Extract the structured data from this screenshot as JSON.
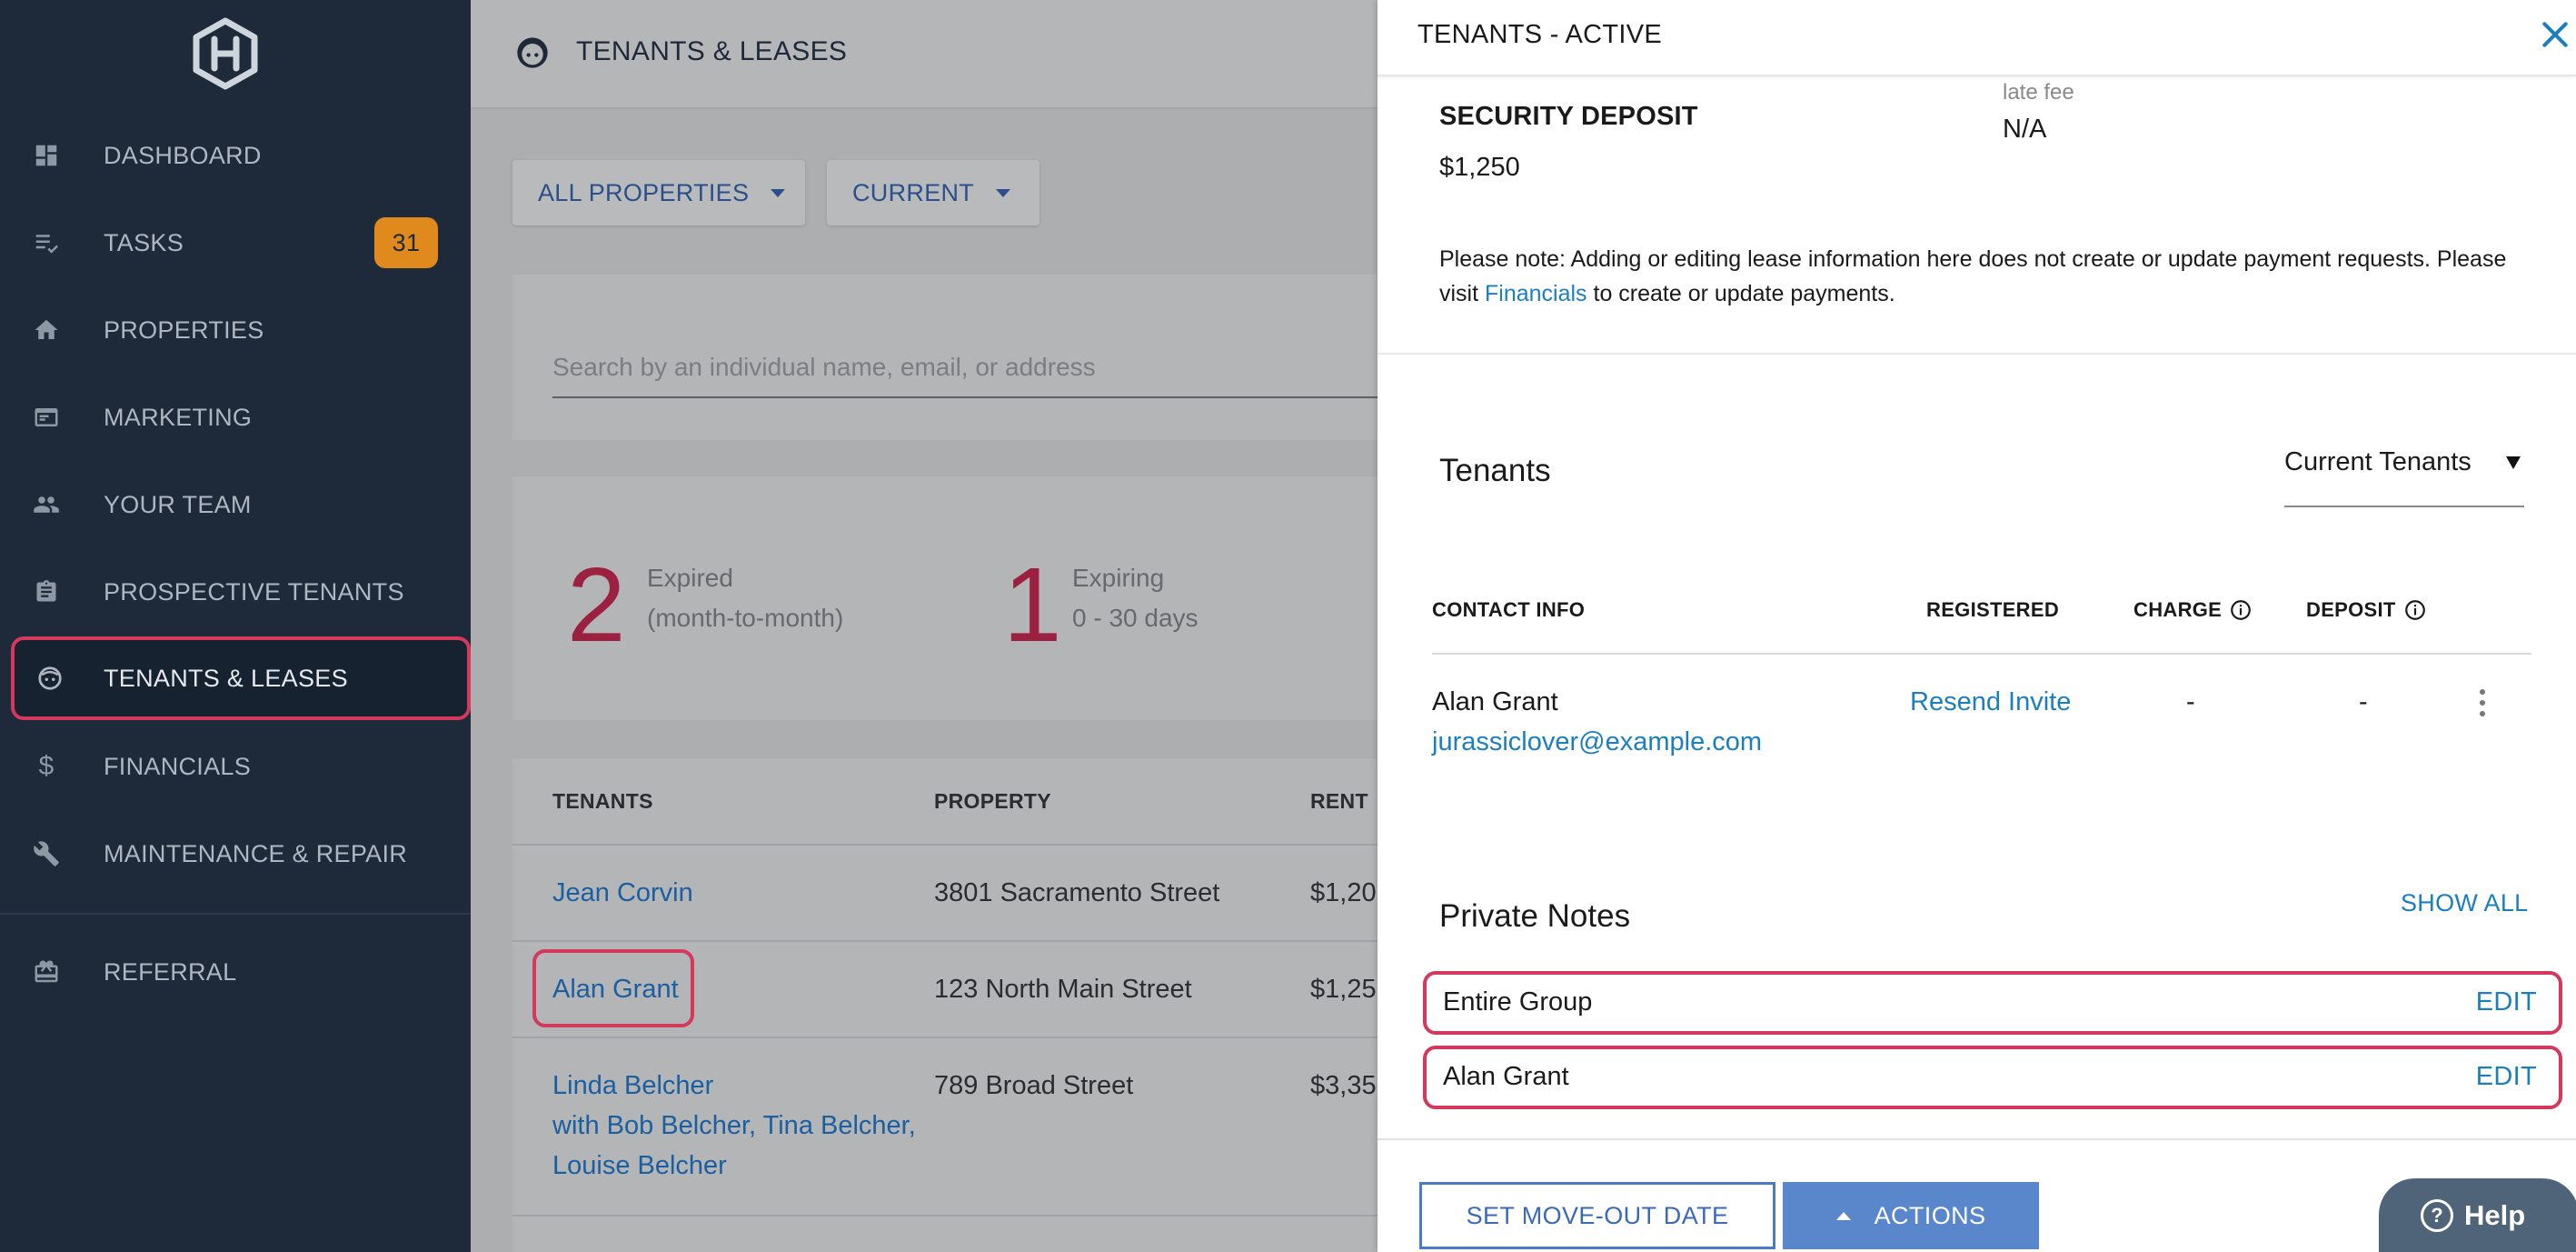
{
  "sidebar": {
    "items": [
      {
        "label": "DASHBOARD",
        "icon": "dashboard-icon"
      },
      {
        "label": "TASKS",
        "icon": "tasks-icon",
        "badge": "31"
      },
      {
        "label": "PROPERTIES",
        "icon": "home-icon"
      },
      {
        "label": "MARKETING",
        "icon": "marketing-icon"
      },
      {
        "label": "YOUR TEAM",
        "icon": "team-icon"
      },
      {
        "label": "PROSPECTIVE TENANTS",
        "icon": "clipboard-icon"
      },
      {
        "label": "TENANTS & LEASES",
        "icon": "tenant-face-icon",
        "active": true
      },
      {
        "label": "FINANCIALS",
        "icon": "dollar-icon"
      },
      {
        "label": "MAINTENANCE & REPAIR",
        "icon": "wrench-icon"
      },
      {
        "label": "REFERRAL",
        "icon": "gift-icon"
      }
    ]
  },
  "main": {
    "page_title": "TENANTS & LEASES",
    "filters": {
      "properties": "ALL PROPERTIES",
      "status": "CURRENT"
    },
    "search": {
      "placeholder": "Search by an individual name, email, or address",
      "value": ""
    },
    "stats": [
      {
        "number": "2",
        "line1": "Expired",
        "line2": "(month-to-month)"
      },
      {
        "number": "1",
        "line1": "Expiring",
        "line2": "0 - 30 days"
      }
    ],
    "table": {
      "headers": {
        "tenants": "TENANTS",
        "property": "PROPERTY",
        "rent": "RENT"
      },
      "rows": [
        {
          "tenant": "Jean Corvin",
          "property": "3801 Sacramento Street",
          "rent": "$1,20"
        },
        {
          "tenant": "Alan Grant",
          "property": "123 North Main Street",
          "rent": "$1,25"
        },
        {
          "tenant": "Linda Belcher",
          "with1": "with Bob Belcher, Tina Belcher,",
          "with2": "Louise Belcher",
          "property": "789 Broad Street",
          "rent": "$3,35"
        }
      ]
    }
  },
  "drawer": {
    "title": "TENANTS - ACTIVE",
    "security_deposit": {
      "label": "SECURITY DEPOSIT",
      "value": "$1,250"
    },
    "late_fee": {
      "label": "late fee",
      "value": "N/A"
    },
    "note": {
      "before": "Please note: Adding or editing lease information here does not create or update payment requests. Please visit ",
      "link": "Financials",
      "after": " to create or update payments."
    },
    "tenants_section": {
      "title": "Tenants",
      "select_value": "Current Tenants",
      "headers": {
        "contact": "CONTACT INFO",
        "registered": "REGISTERED",
        "charge": "CHARGE",
        "deposit": "DEPOSIT"
      },
      "row": {
        "name": "Alan Grant",
        "email": "jurassiclover@example.com",
        "registered": "Resend Invite",
        "charge": "-",
        "deposit": "-"
      }
    },
    "private_notes": {
      "title": "Private Notes",
      "show_all": "SHOW ALL",
      "items": [
        {
          "label": "Entire Group",
          "action": "EDIT"
        },
        {
          "label": "Alan Grant",
          "action": "EDIT"
        }
      ]
    },
    "footer": {
      "move_out": "SET MOVE-OUT DATE",
      "actions": "ACTIONS"
    },
    "help": "Help"
  },
  "colors": {
    "sidebar_bg": "#1e2a3a",
    "accent_blue": "#1b7fbf",
    "highlight": "#d4385c",
    "badge": "#e08a1e",
    "stat_red": "#9c2040"
  }
}
